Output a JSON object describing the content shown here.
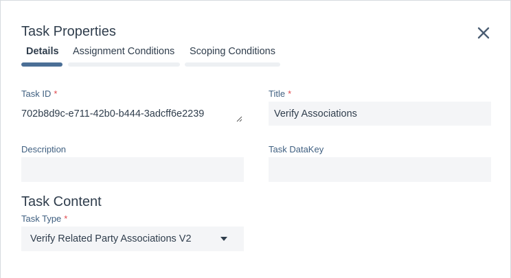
{
  "dialog": {
    "title": "Task Properties",
    "close_icon": "close-icon"
  },
  "tabs": [
    {
      "label": "Details",
      "active": true
    },
    {
      "label": "Assignment Conditions",
      "active": false
    },
    {
      "label": "Scoping Conditions",
      "active": false
    }
  ],
  "fields": {
    "task_id": {
      "label": "Task ID",
      "required": "*",
      "value": "702b8d9c-e711-42b0-b444-3adcff6e2239"
    },
    "title": {
      "label": "Title",
      "required": "*",
      "value": "Verify Associations"
    },
    "description": {
      "label": "Description",
      "value": ""
    },
    "task_datakey": {
      "label": "Task DataKey",
      "value": ""
    }
  },
  "task_content": {
    "heading": "Task Content",
    "task_type": {
      "label": "Task Type",
      "required": "*",
      "value": "Verify Related Party Associations V2"
    }
  },
  "colors": {
    "accent": "#4b6f96",
    "required": "#e0474c",
    "field_bg": "#f4f5f7"
  }
}
